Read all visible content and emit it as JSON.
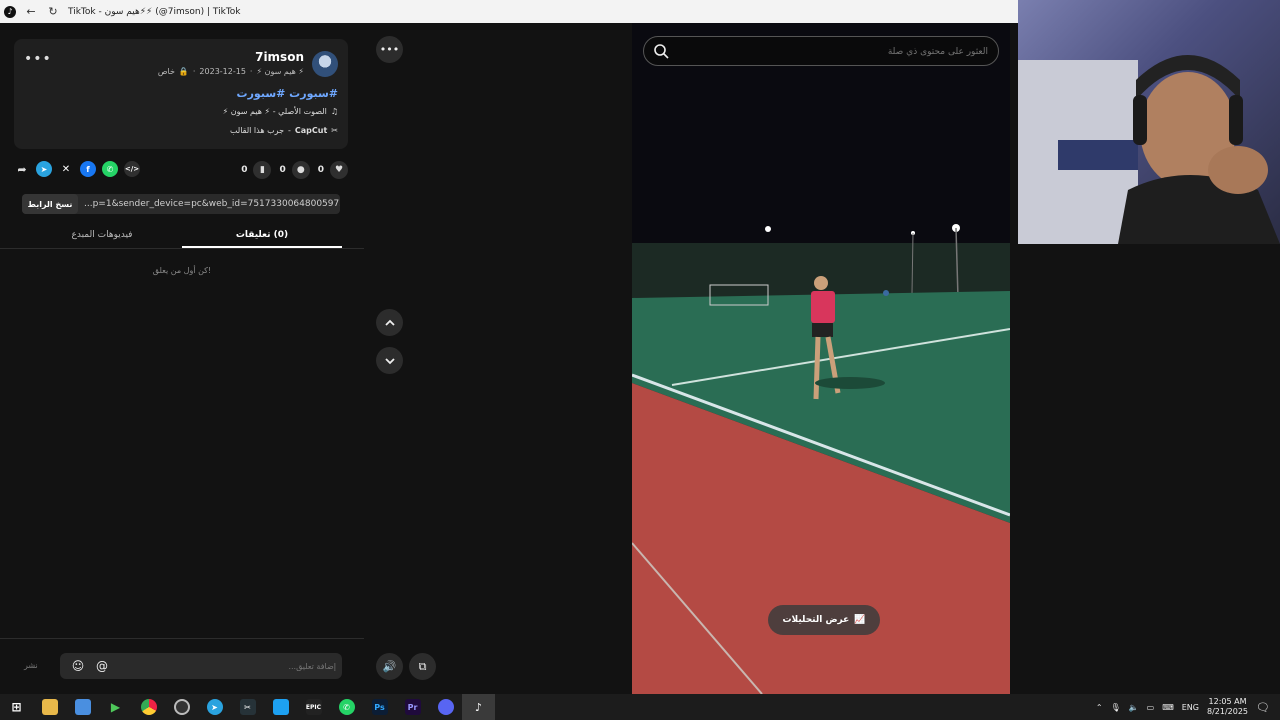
{
  "window": {
    "title": "TikTok - هيم سون⚡⚡ (@7imson) | TikTok"
  },
  "post": {
    "username": "7imson",
    "display_name": "⚡ هيم سون ⚡",
    "date": "2023-12-15",
    "privacy": "خاص",
    "hashtags": "#ﺳﺒﻮﺭﺕ #ﺳﺒﻮﺭﺕ",
    "sound": "الصوت الأصلي - ⚡ هيم سون ⚡",
    "capcut_label": "CapCut",
    "capcut_action": "جرب هذا القالب",
    "likes": "0",
    "comments_count": "0",
    "saves": "0"
  },
  "link": {
    "copy_label": "نسخ الرابط",
    "url": "...p=1&sender_device=pc&web_id=7517330064800597511"
  },
  "tabs": [
    {
      "label": "(0) تعليقات"
    },
    {
      "label": "فيديوهات المبدع"
    }
  ],
  "comments": {
    "empty_text": "كن أول من يعلق!",
    "placeholder": "إضافة تعليق...",
    "post_label": "نشر"
  },
  "video": {
    "search_placeholder": "العثور على محتوى ذي صلة",
    "analytics_label": "عرض التحليلات"
  },
  "tray": {
    "lang": "ENG",
    "time": "12:05 AM",
    "date": "8/21/2025"
  },
  "colors": {
    "accent_link": "#6fa8ff",
    "background": "#121212"
  }
}
